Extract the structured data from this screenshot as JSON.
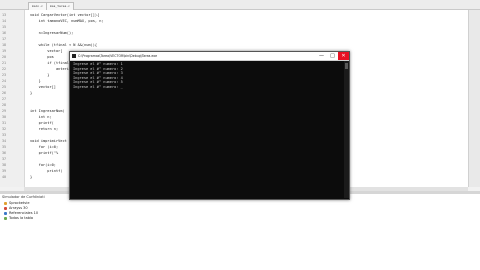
{
  "editor": {
    "tabs": [
      "main.c",
      "mas_tarea.c"
    ],
    "line_numbers": [
      "13",
      "14",
      "15",
      "16",
      "17",
      "18",
      "19",
      "20",
      "21",
      "22",
      "23",
      "24",
      "25",
      "26",
      "27",
      "28",
      "29",
      "30",
      "31",
      "32",
      "33",
      "34",
      "35",
      "36",
      "37",
      "38",
      "39",
      "40"
    ],
    "code_lines": [
      "void CargarVector(int vector[]){",
      "    int tamanoVEC, numMAX, pos, n;",
      "",
      "    n=IngresarNum();",
      "",
      "    while (tfinal < N &&(num)){",
      "        vector[",
      "        pos",
      "        if (tfinal",
      "            anteriores",
      "        }",
      "    }",
      "    vector[]",
      "}",
      "",
      "",
      "int IngresarNum(",
      "    int n;",
      "    printf(",
      "    return n;",
      "",
      "void imprimirVect",
      "    for (i=0;",
      "    printf(\"%",
      "",
      "    for(i=0;",
      "        printf(",
      "}"
    ]
  },
  "console": {
    "title": "C:\\Programas\\Tarea\\VECTOR\\bin\\Debug\\Tarea.exe",
    "minimize": "—",
    "maximize": "□",
    "close": "✕",
    "output_lines": [
      "Ingrese el #° numero: 1",
      "Ingrese el #° numero: 2",
      "Ingrese el #° numero: 3",
      "Ingrese el #° numero: 4",
      "Ingrese el #° numero: 5",
      "Ingrese el #° numero: _"
    ]
  },
  "panel": {
    "title": "Simulador de Curfdiniati",
    "tree_items": [
      "Sprocketvie",
      "Arrayss 30",
      "Referenciales 10",
      "Todas la tabla"
    ],
    "icon_colors": [
      "#e0a030",
      "#d24a3a",
      "#3c78c8",
      "#6aa84f"
    ]
  }
}
